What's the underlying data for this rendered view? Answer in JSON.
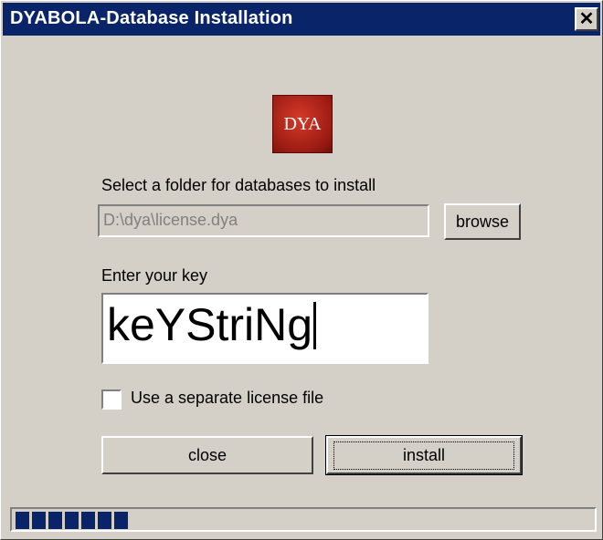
{
  "window": {
    "title": "DYABOLA-Database Installation",
    "close_glyph": "✕",
    "close_icon": "close-icon"
  },
  "logo": {
    "text": "DYA",
    "color": "#b5231a"
  },
  "folder": {
    "label": "Select a folder for databases to install",
    "value": "D:\\dya\\license.dya",
    "browse_label": "browse"
  },
  "key": {
    "label": "Enter your key",
    "value": "keYStriNg"
  },
  "license_option": {
    "label": "Use a separate license file",
    "checked": false
  },
  "actions": {
    "close_label": "close",
    "install_label": "install"
  },
  "progress": {
    "blocks_filled": 7,
    "color": "#0a246a"
  },
  "colors": {
    "titlebar": "#0a246a",
    "face": "#d4d0c8"
  }
}
